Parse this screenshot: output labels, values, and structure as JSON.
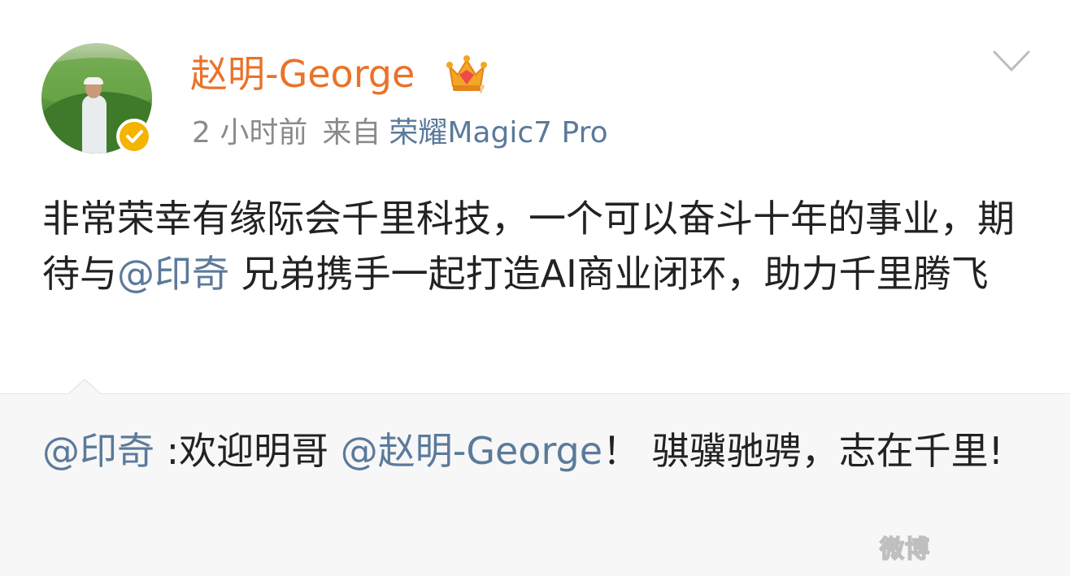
{
  "author": {
    "name": "赵明-George",
    "avatar_icon": "user-photo",
    "verified_icon": "verified-badge-icon",
    "member_badge_icon": "crown-icon",
    "name_color": "#eb7229"
  },
  "meta": {
    "time": "2 小时前",
    "from_label": "来自",
    "device": "荣耀Magic7 Pro"
  },
  "post": {
    "text_before": "非常荣幸有缘际会千里科技，一个可以奋斗十年的事业，期待与",
    "mention": "@印奇",
    "text_after": " 兄弟携手一起打造AI商业闭环，助力千里腾飞"
  },
  "repost": {
    "mention_author": "@印奇",
    "text_1": " :欢迎明哥 ",
    "mention_2": "@赵明-George",
    "text_2": "！ 骐骥驰骋，志在千里!"
  },
  "watermark": "微博",
  "colors": {
    "link": "#5b7a9b",
    "text": "#222222",
    "muted": "#8a8a8a",
    "repost_bg": "#f7f7f7"
  }
}
